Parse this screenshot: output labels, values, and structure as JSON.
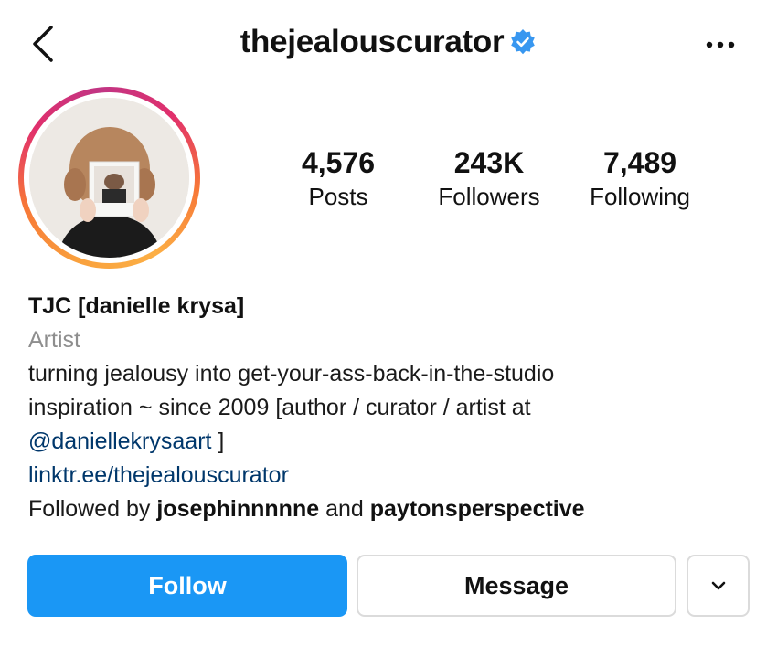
{
  "header": {
    "username": "thejealouscurator",
    "verified": true,
    "back_icon": "chevron-left-icon",
    "more_icon": "ellipsis-icon",
    "verified_color": "#3897f0"
  },
  "stats": [
    {
      "value": "4,576",
      "label": "Posts"
    },
    {
      "value": "243K",
      "label": "Followers"
    },
    {
      "value": "7,489",
      "label": "Following"
    }
  ],
  "bio": {
    "name": "TJC [danielle krysa]",
    "category": "Artist",
    "line1": "turning jealousy into get-your-ass-back-in-the-studio",
    "line2": "inspiration ~ since 2009 [author / curator / artist at",
    "mention": "@daniellekrysaart",
    "mention_suffix": " ]",
    "link": "linktr.ee/thejealouscurator",
    "followed_prefix": "Followed by ",
    "followed_user1": "josephinnnnne",
    "followed_and": " and ",
    "followed_user2": "paytonsperspective"
  },
  "actions": {
    "follow_label": "Follow",
    "message_label": "Message",
    "dropdown_icon": "chevron-down-icon"
  },
  "colors": {
    "accent": "#1a97f5",
    "link": "#00376b",
    "muted": "#8e8e8e"
  }
}
